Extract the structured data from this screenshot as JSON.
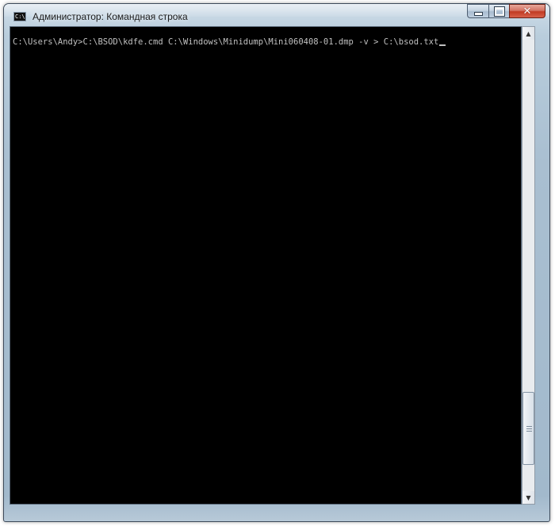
{
  "window": {
    "title": "Администратор: Командная строка",
    "icon_label": "C:\\",
    "icon": "console-icon"
  },
  "controls": {
    "minimize_icon": "minimize-icon",
    "maximize_icon": "maximize-icon",
    "close_icon": "close-icon"
  },
  "console": {
    "text": "C:\\Users\\Andy>C:\\BSOD\\kdfe.cmd C:\\Windows\\Minidump\\Mini060408-01.dmp -v > C:\\bsod.txt",
    "background": "#000000",
    "foreground": "#c0c0c0"
  },
  "scrollbar": {
    "up_arrow": "▲",
    "down_arrow": "▼",
    "position": 0.93
  }
}
